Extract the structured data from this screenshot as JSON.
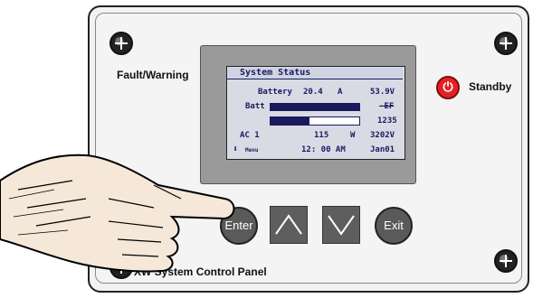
{
  "panel": {
    "fault_warning_label": "Fault/Warning",
    "standby_label": "Standby",
    "standby_icon": "power-icon",
    "bottom_label": "XW System Control Panel"
  },
  "display": {
    "title": "System Status",
    "rows": [
      {
        "label": "Battery",
        "value": "20.4",
        "unit": "A",
        "right": "53.9V"
      },
      {
        "label": "Batt",
        "right": "-EF"
      },
      {
        "right": "1235"
      },
      {
        "label": "AC 1",
        "value": "115",
        "unit": "W",
        "right": "3202V"
      }
    ],
    "footer": {
      "menu_icon": "arrow-down-icon",
      "menu_label": "Menu",
      "time": "12: 00  AM",
      "date": "Jan01"
    }
  },
  "buttons": {
    "enter": "Enter",
    "up_icon": "chevron-up-icon",
    "down_icon": "chevron-down-icon",
    "exit": "Exit"
  },
  "colors": {
    "lcd_text": "#1a1a5e",
    "lcd_bg": "#d8dbe4",
    "standby": "#e62020",
    "fault_led": "#e66a6a"
  }
}
